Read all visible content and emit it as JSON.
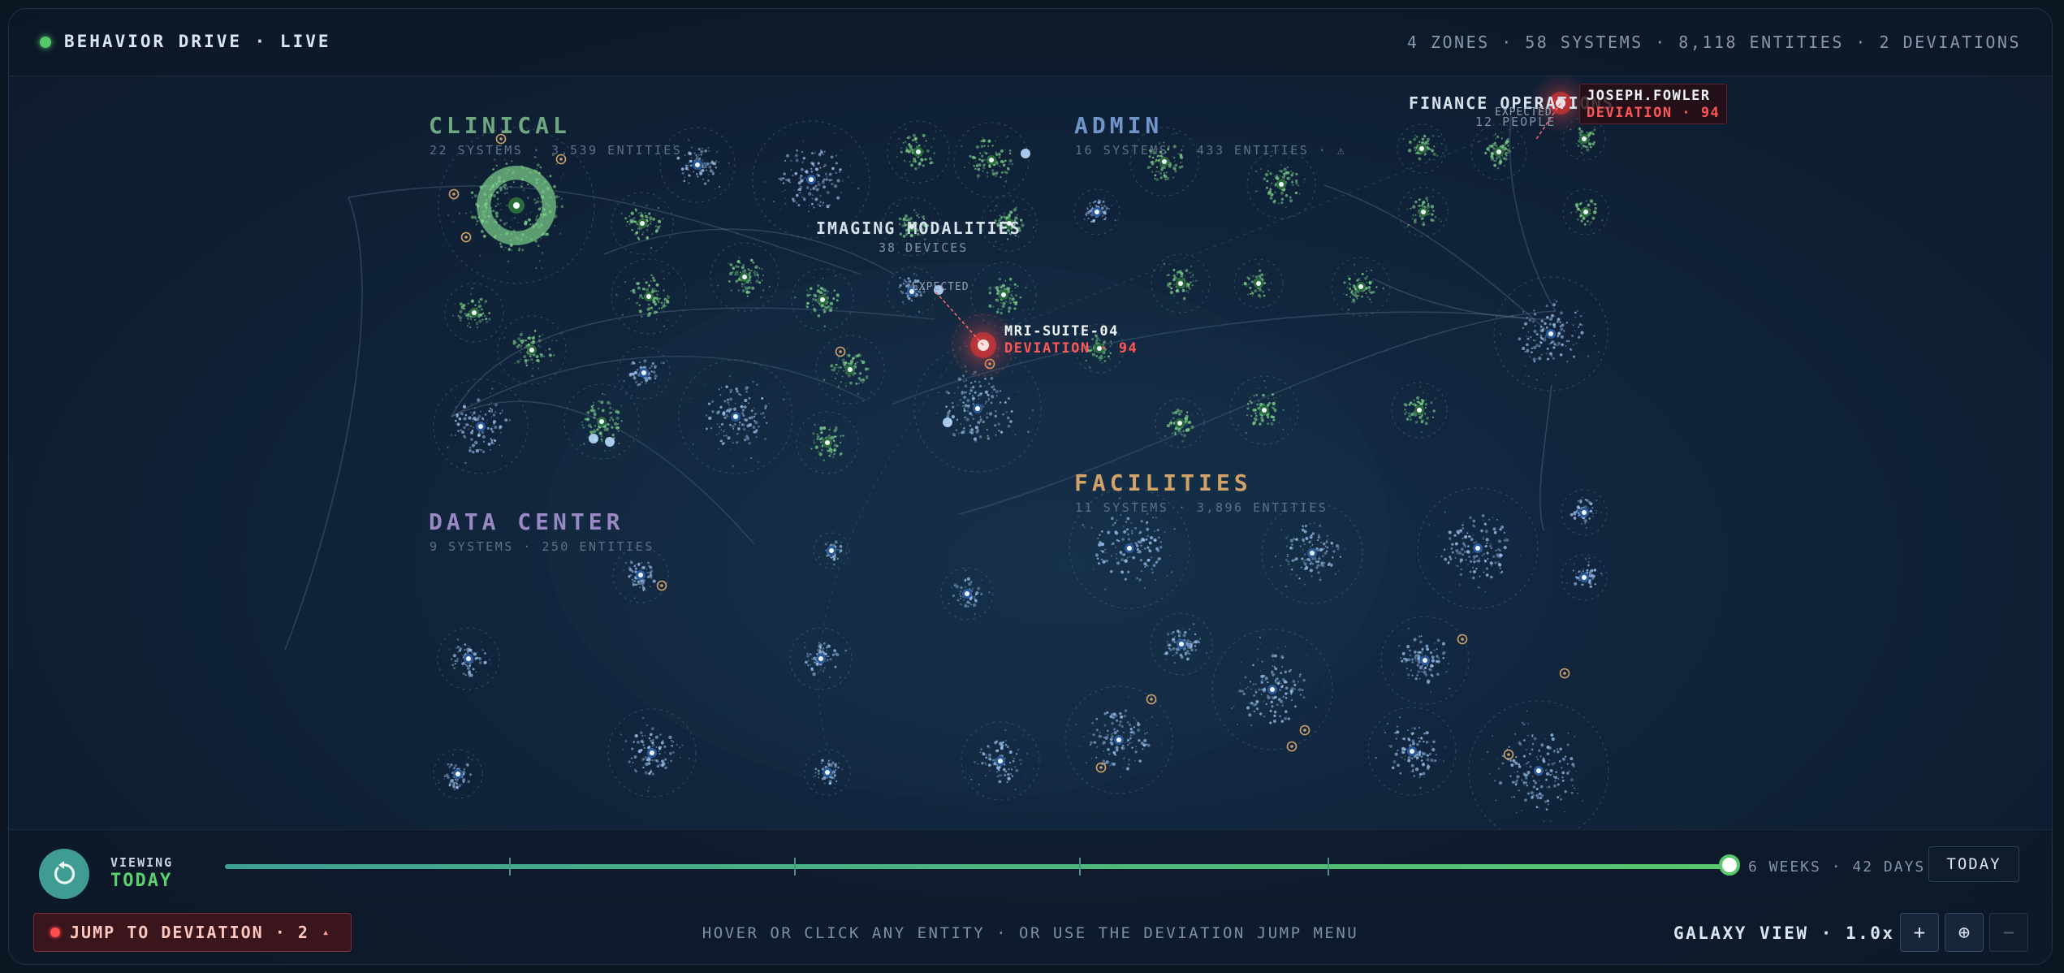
{
  "header": {
    "title": "BEHAVIOR DRIVE · LIVE",
    "stats": "4 ZONES · 58 SYSTEMS · 8,118 ENTITIES · 2 DEVIATIONS"
  },
  "zones": {
    "clinical": {
      "name": "CLINICAL",
      "sub": "22 SYSTEMS · 3,539 ENTITIES"
    },
    "admin": {
      "name": "ADMIN",
      "sub": "16 SYSTEMS · 433 ENTITIES · ⚠"
    },
    "data_center": {
      "name": "DATA CENTER",
      "sub": "9 SYSTEMS · 250 ENTITIES"
    },
    "facilities": {
      "name": "FACILITIES",
      "sub": "11 SYSTEMS · 3,896 ENTITIES"
    }
  },
  "clusters": {
    "imaging": {
      "title": "IMAGING MODALITIES",
      "sub": "38 DEVICES",
      "expected": "EXPECTED"
    },
    "finance": {
      "title": "FINANCE OPERATIONS",
      "sub": "12 PEOPLE",
      "expected": "EXPECTED"
    }
  },
  "deviations": [
    {
      "name": "MRI-SUITE-04",
      "label": "DEVIATION · 94"
    },
    {
      "name": "JOSEPH.FOWLER",
      "label": "DEVIATION · 94"
    }
  ],
  "timeline": {
    "viewing_label": "VIEWING",
    "viewing_value": "TODAY",
    "range": "6 WEEKS · 42 DAYS",
    "today_button": "TODAY",
    "position": 1.0,
    "reset_icon": "reset-icon"
  },
  "footer": {
    "jump_button": "JUMP TO DEVIATION · 2",
    "jump_chevron": "▴",
    "hint": "HOVER OR CLICK ANY ENTITY · OR USE THE DEVIATION JUMP MENU",
    "view": "GALAXY VIEW · 1.0x",
    "zoom_in": "+",
    "recenter": "⊕",
    "zoom_out": "−"
  },
  "colors": {
    "live": "#54c86a",
    "clinical": "#6fa781",
    "admin": "#6f95c9",
    "data_center": "#9a88c4",
    "facilities": "#d2a268",
    "deviation": "#ff4d4d",
    "green_node": "#7ed28a",
    "blue_node": "#9ec3ef"
  }
}
